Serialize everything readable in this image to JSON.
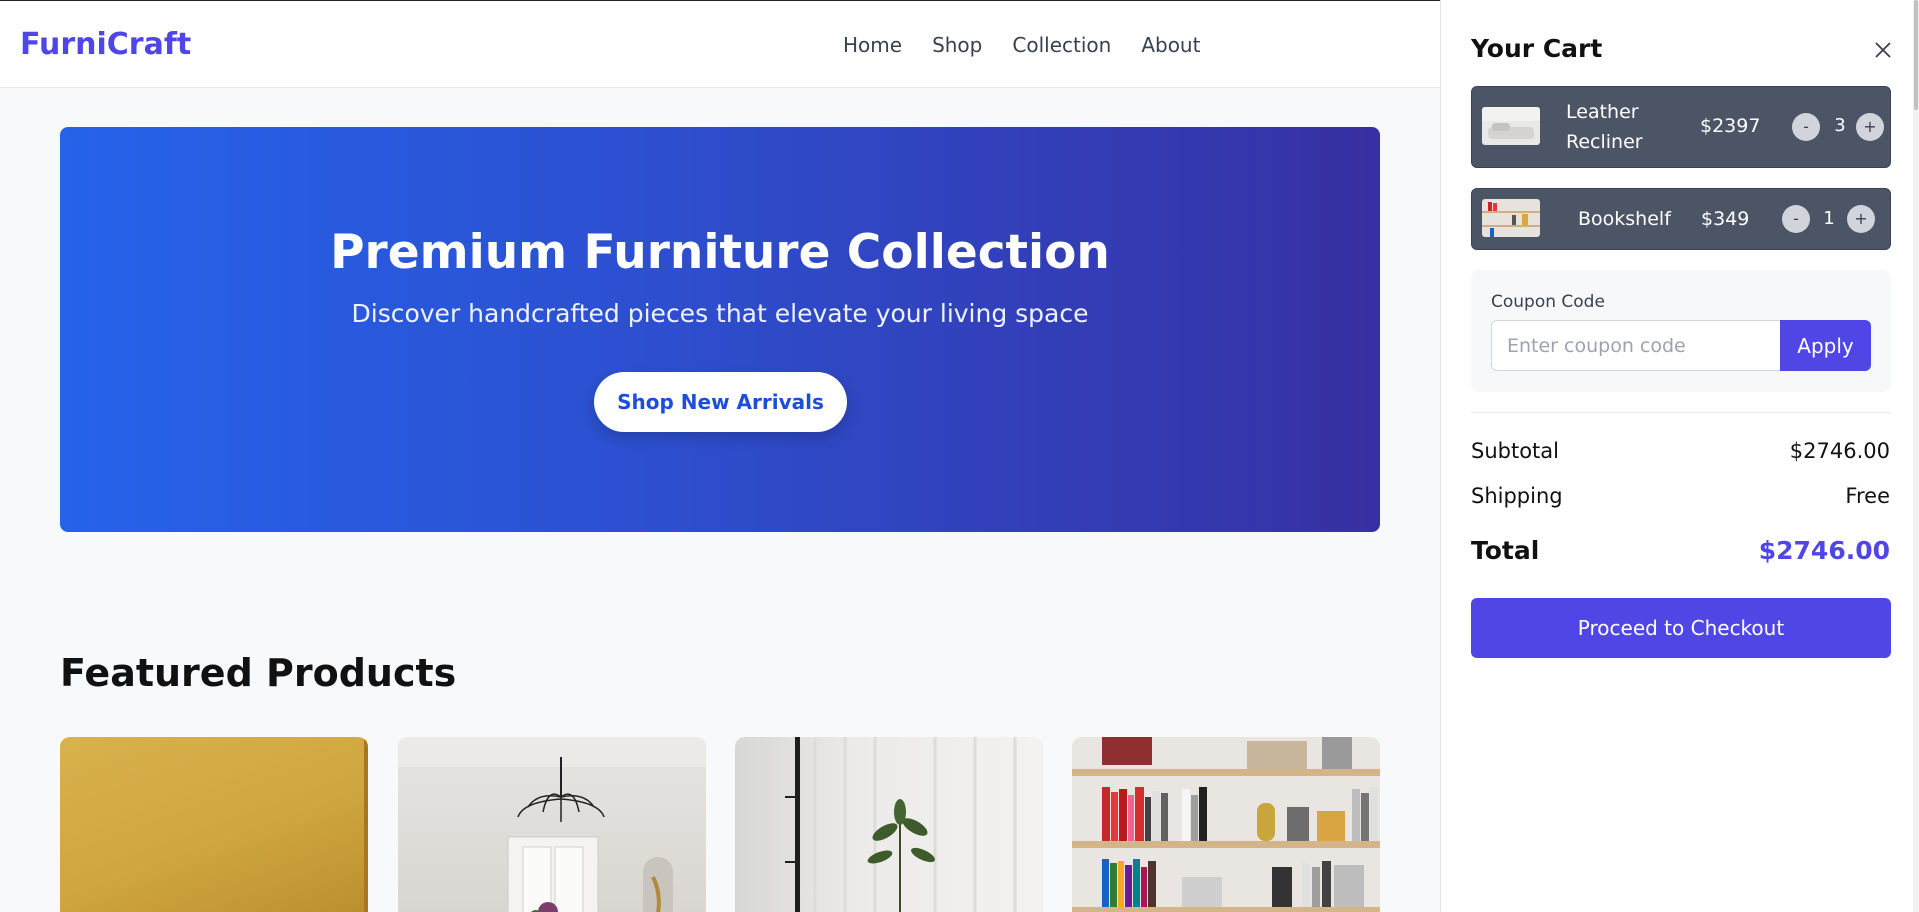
{
  "brand": {
    "name": "FurniCraft"
  },
  "nav": {
    "items": [
      "Home",
      "Shop",
      "Collection",
      "About"
    ]
  },
  "hero": {
    "title": "Premium Furniture Collection",
    "subtitle": "Discover handcrafted pieces that elevate your living space",
    "cta_label": "Shop New Arrivals"
  },
  "featured": {
    "title": "Featured Products"
  },
  "cart": {
    "title": "Your Cart",
    "items": [
      {
        "name": "Leather Recliner",
        "price": "$2397",
        "qty": "3",
        "minus": "-",
        "plus": "+"
      },
      {
        "name": "Bookshelf",
        "price": "$349",
        "qty": "1",
        "minus": "-",
        "plus": "+"
      }
    ],
    "coupon": {
      "label": "Coupon Code",
      "placeholder": "Enter coupon code",
      "apply_label": "Apply"
    },
    "subtotal": {
      "label": "Subtotal",
      "value": "$2746.00"
    },
    "shipping": {
      "label": "Shipping",
      "value": "Free"
    },
    "total": {
      "label": "Total",
      "value": "$2746.00"
    },
    "checkout_label": "Proceed to Checkout"
  },
  "colors": {
    "accent": "#4f46e5",
    "hero_start": "#2563eb",
    "hero_end": "#3730a3",
    "cart_item_bg": "#4b5565"
  }
}
